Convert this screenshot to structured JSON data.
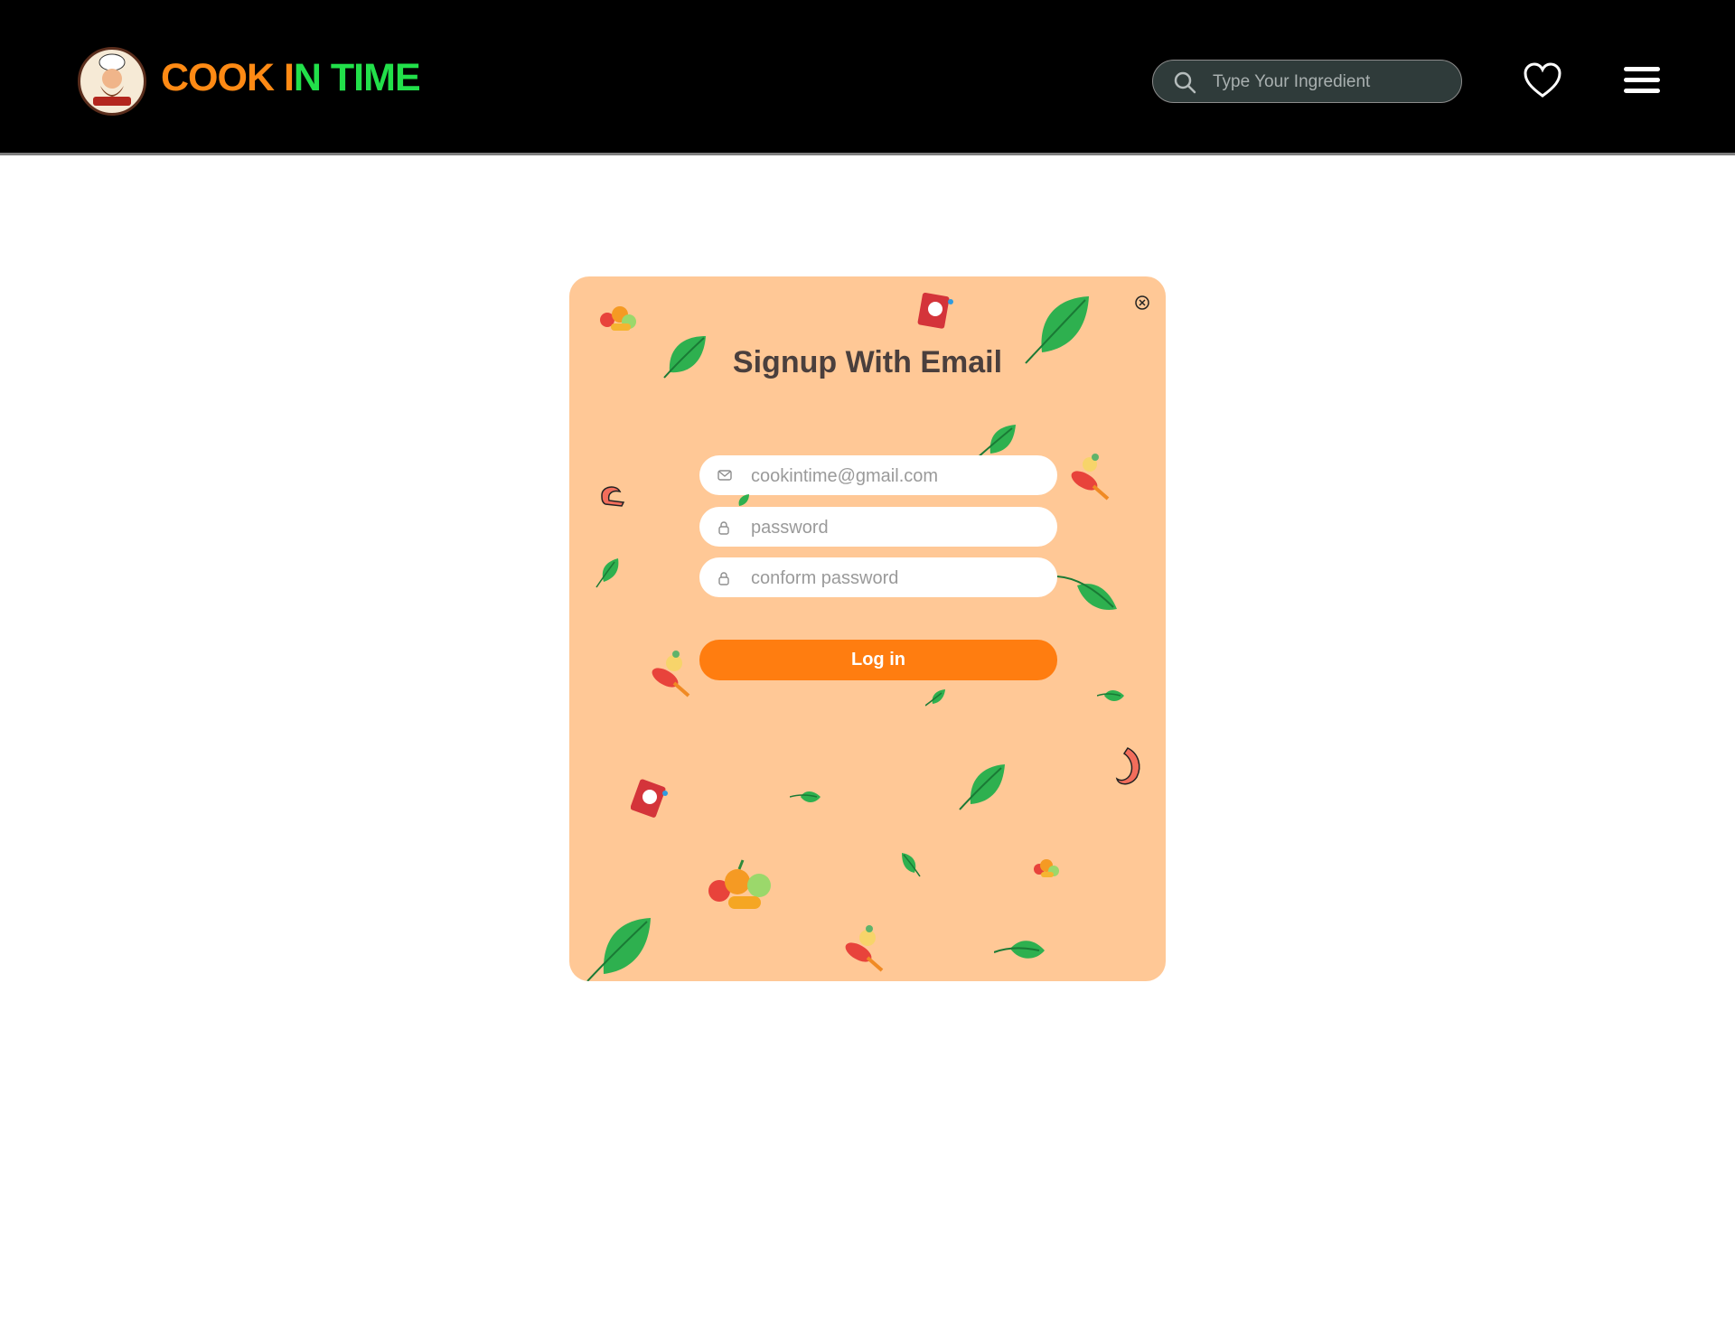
{
  "brand": {
    "part1": "COOK I",
    "part2": "N TIME",
    "badge_text": "COOK IN TIME"
  },
  "search": {
    "placeholder": "Type Your Ingredient"
  },
  "icons": {
    "search": "search-icon",
    "favorites": "heart-icon",
    "menu": "hamburger-menu-icon",
    "close": "close-icon",
    "email": "mail-icon",
    "lock": "lock-icon"
  },
  "signup": {
    "title": "Signup With Email",
    "email_placeholder": "cookintime@gmail.com",
    "password_placeholder": "password",
    "confirm_placeholder": "conform password",
    "submit_label": "Log in"
  },
  "colors": {
    "header_bg": "#000000",
    "accent_orange": "#ff8a14",
    "accent_green": "#22e04a",
    "card_bg": "#ffc896",
    "button": "#ff7d10"
  }
}
